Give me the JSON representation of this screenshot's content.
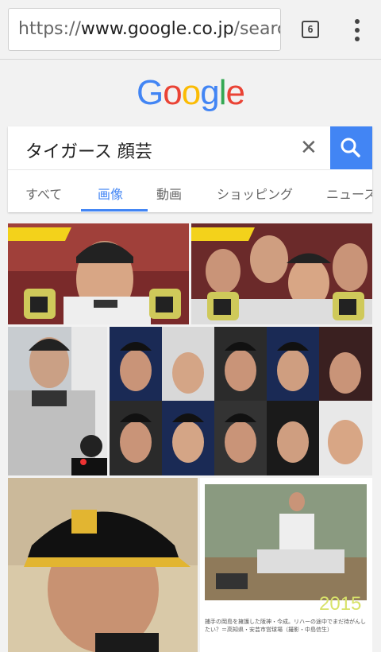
{
  "browser": {
    "url_scheme": "https://",
    "url_host": "www.google.co.jp",
    "url_path": "/search?",
    "tab_count": "6"
  },
  "logo": {
    "letters": [
      "G",
      "o",
      "o",
      "g",
      "l",
      "e"
    ],
    "colors": [
      "#4285f4",
      "#ea4335",
      "#fbbc05",
      "#4285f4",
      "#34a853",
      "#ea4335"
    ]
  },
  "search": {
    "query": "タイガース 顔芸"
  },
  "tabs": [
    {
      "label": "すべて"
    },
    {
      "label": "画像"
    },
    {
      "label": "動画"
    },
    {
      "label": "ショッピング"
    },
    {
      "label": "ニュース"
    }
  ],
  "accent": "#4285f4",
  "results": {
    "caption_6": "捕手の岡島を擁護した阪神・今成。リハーの途中でまだ待がんしたい？＝高知県・安芸市営球場（撮影・中島信生）",
    "year_6": "2015"
  }
}
